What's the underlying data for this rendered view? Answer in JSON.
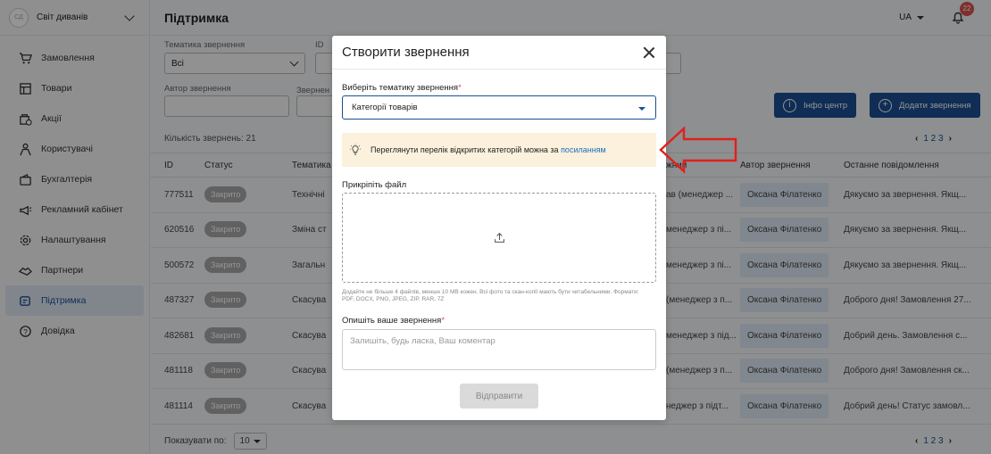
{
  "sidebar": {
    "brand_logo": "СД",
    "brand_name": "Світ диванів",
    "items": [
      {
        "label": "Замовлення",
        "icon": "cart-icon"
      },
      {
        "label": "Товари",
        "icon": "products-icon"
      },
      {
        "label": "Акції",
        "icon": "promo-icon"
      },
      {
        "label": "Користувачі",
        "icon": "users-icon"
      },
      {
        "label": "Бухгалтерія",
        "icon": "wallet-icon"
      },
      {
        "label": "Рекламний кабінет",
        "icon": "megaphone-icon"
      },
      {
        "label": "Налаштування",
        "icon": "gear-icon"
      },
      {
        "label": "Партнери",
        "icon": "handshake-icon"
      },
      {
        "label": "Підтримка",
        "icon": "support-icon",
        "active": true
      },
      {
        "label": "Довідка",
        "icon": "help-icon"
      }
    ]
  },
  "header": {
    "title": "Підтримка",
    "language": "UA",
    "notifications_count": "22"
  },
  "filters": {
    "topic_label": "Тематика звернення",
    "topic_value": "Всі",
    "id_label": "ID ",
    "author_label": "Автор звернення",
    "author_value": "",
    "status_label": "Звернен"
  },
  "actions": {
    "info_center": "Інфо центр",
    "add_request": "Додати звернення"
  },
  "count_label": "Кількість звернень: 21",
  "pagination": {
    "pages": "1 2 3"
  },
  "table": {
    "headers": {
      "id": "ID",
      "status": "Статус",
      "topic": "Тематика з",
      "manager": "жний",
      "author": "Автор звернення",
      "last_message": "Останне повідомлення"
    },
    "rows": [
      {
        "id": "777511",
        "status": "Закрито",
        "topic": "Технічні",
        "manager": "ав (менеджер ...",
        "author": "Оксана Філатенко",
        "message": "Дякуємо за звернення. Якщ..."
      },
      {
        "id": "620516",
        "status": "Закрито",
        "topic": "Зміна ст",
        "manager": "менеджер з пі...",
        "author": "Оксана Філатенко",
        "message": "Дякуємо за звернення. Якщ..."
      },
      {
        "id": "500572",
        "status": "Закрито",
        "topic": "Загальн",
        "manager": "менеджер з пі...",
        "author": "Оксана Філатенко",
        "message": "Дякуємо за звернення. Якщ..."
      },
      {
        "id": "487327",
        "status": "Закрито",
        "topic": "Скасува",
        "manager": "(менеджер з п...",
        "author": "Оксана Філатенко",
        "message": "Доброго дня! Замовлення 27..."
      },
      {
        "id": "482681",
        "status": "Закрито",
        "topic": "Скасува",
        "manager": "менеджер з під...",
        "author": "Оксана Філатенко",
        "message": "Добрий день. Замовлення с..."
      },
      {
        "id": "481118",
        "status": "Закрито",
        "topic": "Скасува",
        "manager": "(менеджер з п...",
        "author": "Оксана Філатенко",
        "message": "Доброго дня! Замовлення ск..."
      },
      {
        "id": "481114",
        "status": "Закрито",
        "topic": "Скасува",
        "manager": "неджер з підт...",
        "author": "Оксана Філатенко",
        "message": "Добрий день! Статус замовл..."
      }
    ]
  },
  "footer": {
    "show_label": "Показувати по:",
    "per_page": "10"
  },
  "modal": {
    "title": "Створити звернення",
    "topic_label": "Виберіть тематику звернення",
    "topic_value": "Категорії товарів",
    "hint_text": "Переглянути перелік відкритих категорій можна за ",
    "hint_link": "посиланням",
    "attach_label": "Прикріпіть файл",
    "attach_note": "Додайте не більше 4 файлів, менше 10 MB кожен. Всі фото та скан-копії мають бути читабельними. Формати: PDF, DOCX, PNG, JPEG, ZIP, RAR, 7Z",
    "describe_label": "Опишіть ваше звернення",
    "describe_placeholder": "Залишіть, будь ласка, Ваш коментар",
    "submit_label": "Відправити",
    "required_mark": "*"
  },
  "colors": {
    "accent": "#1b4f93",
    "annotation_arrow": "#e0201b",
    "badge": "#d9534f"
  }
}
